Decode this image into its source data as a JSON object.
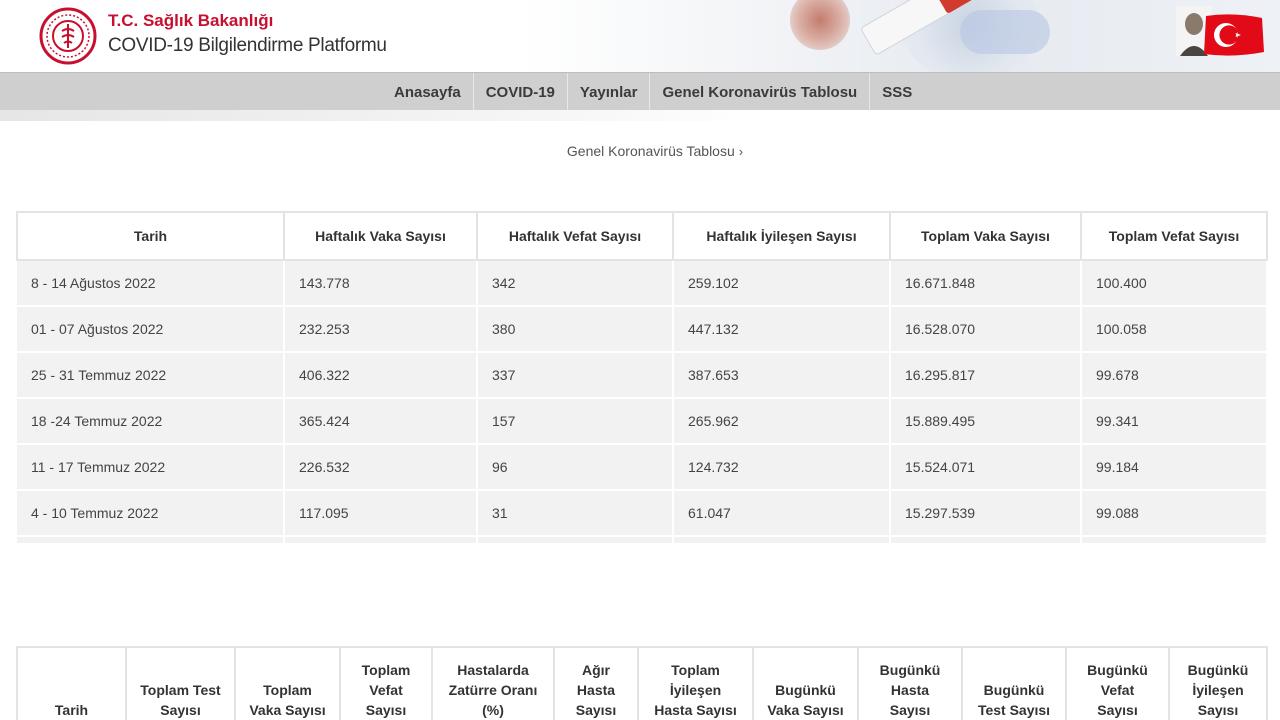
{
  "brand": {
    "title": "T.C. Sağlık Bakanlığı",
    "subtitle": "COVID-19 Bilgilendirme Platformu"
  },
  "icons": {
    "logo": "ministry-logo-icon",
    "portrait": "ataturk-portrait-icon",
    "flag": "turkish-flag-icon",
    "chevron": "chevron-right-icon"
  },
  "colors": {
    "brand_red": "#c8102e",
    "nav_bg": "#cfcfcf",
    "row_bg": "#f2f2f2"
  },
  "nav": {
    "items": [
      "Anasayfa",
      "COVID-19",
      "Yayınlar",
      "Genel Koronavirüs Tablosu",
      "SSS"
    ]
  },
  "breadcrumb": {
    "label": "Genel Koronavirüs Tablosu",
    "chevron": "›"
  },
  "weekly_table": {
    "headers": [
      "Tarih",
      "Haftalık Vaka Sayısı",
      "Haftalık Vefat Sayısı",
      "Haftalık İyileşen Sayısı",
      "Toplam Vaka Sayısı",
      "Toplam Vefat Sayısı"
    ],
    "rows": [
      [
        "8 - 14 Ağustos 2022",
        "143.778",
        "342",
        "259.102",
        "16.671.848",
        "100.400"
      ],
      [
        "01 - 07 Ağustos 2022",
        "232.253",
        "380",
        "447.132",
        "16.528.070",
        "100.058"
      ],
      [
        "25 - 31 Temmuz 2022",
        "406.322",
        "337",
        "387.653",
        "16.295.817",
        "99.678"
      ],
      [
        "18 -24 Temmuz 2022",
        "365.424",
        "157",
        "265.962",
        "15.889.495",
        "99.341"
      ],
      [
        "11 - 17 Temmuz 2022",
        "226.532",
        "96",
        "124.732",
        "15.524.071",
        "99.184"
      ],
      [
        "4 - 10 Temmuz 2022",
        "117.095",
        "31",
        "61.047",
        "15.297.539",
        "99.088"
      ]
    ]
  },
  "daily_table": {
    "headers": [
      [
        "Tarih"
      ],
      [
        "Toplam Test",
        "Sayısı"
      ],
      [
        "Toplam",
        "Vaka Sayısı"
      ],
      [
        "Toplam",
        "Vefat",
        "Sayısı"
      ],
      [
        "Hastalarda",
        "Zatürre Oranı",
        "(%)"
      ],
      [
        "Ağır",
        "Hasta",
        "Sayısı"
      ],
      [
        "Toplam",
        "İyileşen",
        "Hasta Sayısı"
      ],
      [
        "Bugünkü",
        "Vaka Sayısı"
      ],
      [
        "Bugünkü",
        "Hasta",
        "Sayısı"
      ],
      [
        "Bugünkü",
        "Test Sayısı"
      ],
      [
        "Bugünkü",
        "Vefat",
        "Sayısı"
      ],
      [
        "Bugünkü",
        "İyileşen",
        "Sayısı"
      ]
    ]
  }
}
